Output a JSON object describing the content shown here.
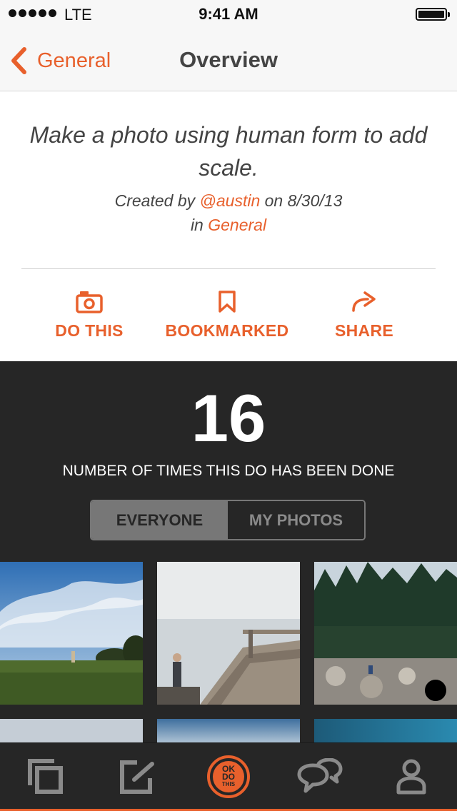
{
  "status_bar": {
    "carrier": "LTE",
    "time": "9:41 AM"
  },
  "nav": {
    "back_label": "General",
    "title": "Overview"
  },
  "prompt": {
    "text": "Make a photo using human form to add scale.",
    "created_by_prefix": "Created by",
    "author": "@austin",
    "on_word": "on",
    "date": "8/30/13",
    "in_word": "in",
    "category": "General"
  },
  "actions": [
    {
      "label": "DO THIS",
      "icon": "camera-icon"
    },
    {
      "label": "BOOKMARKED",
      "icon": "bookmark-icon"
    },
    {
      "label": "SHARE",
      "icon": "share-icon"
    }
  ],
  "stats": {
    "count": "16",
    "label": "NUMBER OF TIMES THIS DO HAS BEEN DONE"
  },
  "segmented": {
    "options": [
      "EVERYONE",
      "MY PHOTOS"
    ],
    "selected": "EVERYONE"
  },
  "tab_bar": {
    "items": [
      "collection-icon",
      "edit-icon",
      "okdothis-logo",
      "chat-icon",
      "profile-icon"
    ],
    "logo_text": [
      "OK",
      "DO",
      "THIS"
    ]
  },
  "colors": {
    "accent": "#e8602c",
    "dark_bg": "#262626",
    "text": "#444444",
    "segment_selected": "#777777"
  }
}
